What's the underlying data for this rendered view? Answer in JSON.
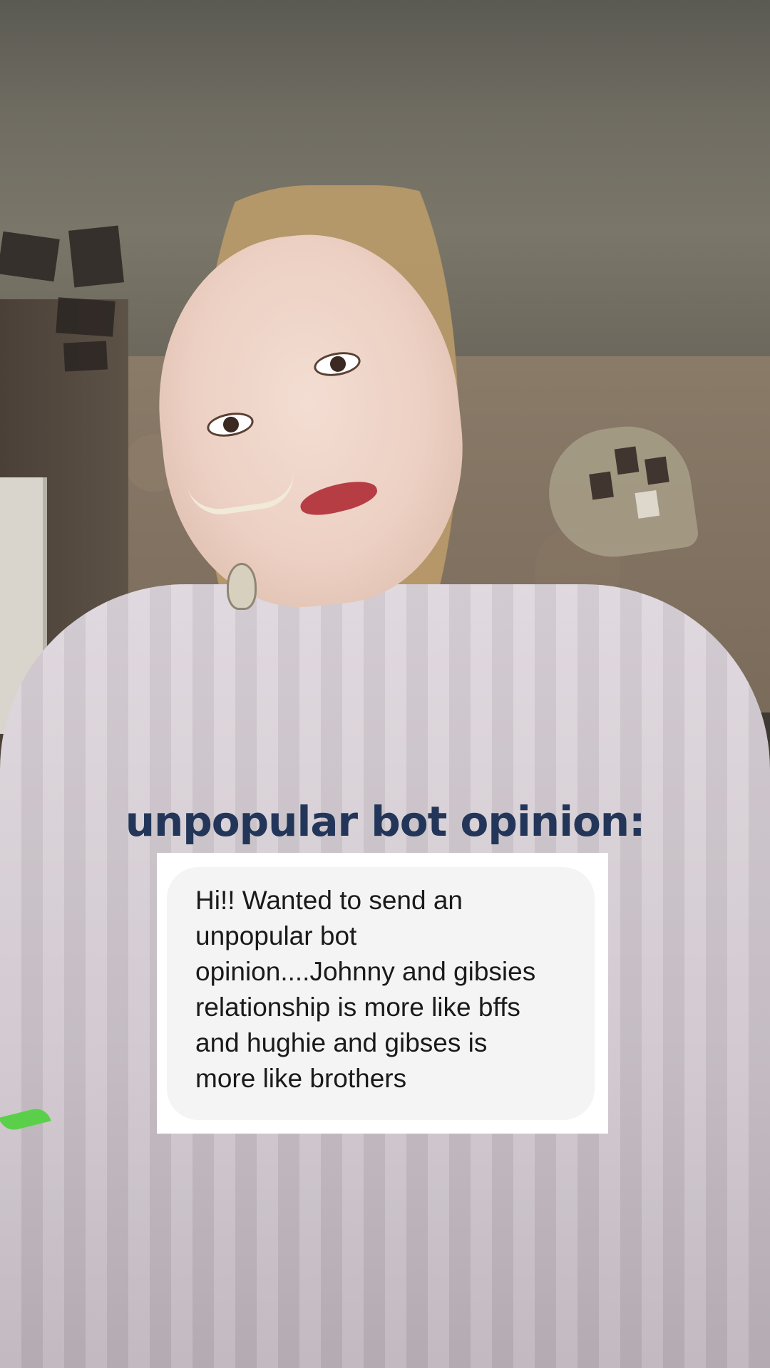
{
  "overlay": {
    "caption": "unpopular bot opinion:",
    "message_lines": [
      "Hi!! Wanted to send an",
      "unpopular bot",
      "opinion....Johnny and gibsies",
      "relationship is more like bffs",
      "and hughie and gibses is",
      "more like brothers"
    ],
    "caption_color": "#23365a",
    "bubble_color": "#f4f4f4",
    "card_color": "#ffffff"
  }
}
